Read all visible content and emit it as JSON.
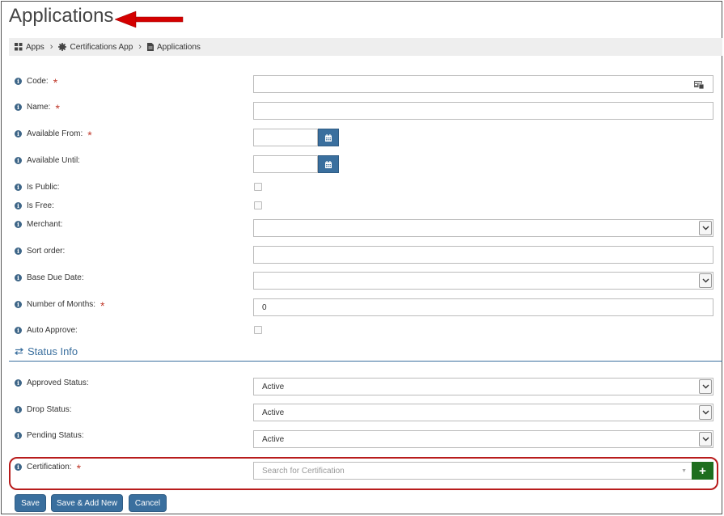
{
  "page": {
    "title": "Applications"
  },
  "breadcrumb": {
    "items": [
      {
        "label": "Apps",
        "icon": "grid-icon"
      },
      {
        "label": "Certifications App",
        "icon": "gear-icon"
      },
      {
        "label": "Applications",
        "icon": "document-icon"
      }
    ]
  },
  "form": {
    "code": {
      "label": "Code:",
      "value": ""
    },
    "name": {
      "label": "Name:",
      "value": ""
    },
    "available_from": {
      "label": "Available From:",
      "value": ""
    },
    "available_until": {
      "label": "Available Until:",
      "value": ""
    },
    "is_public": {
      "label": "Is Public:"
    },
    "is_free": {
      "label": "Is Free:"
    },
    "merchant": {
      "label": "Merchant:",
      "value": ""
    },
    "sort_order": {
      "label": "Sort order:",
      "value": ""
    },
    "base_due_date": {
      "label": "Base Due Date:",
      "value": ""
    },
    "number_of_months": {
      "label": "Number of Months:",
      "value": "0"
    },
    "auto_approve": {
      "label": "Auto Approve:"
    }
  },
  "status_section": {
    "title": "Status Info",
    "approved_status": {
      "label": "Approved Status:",
      "value": "Active"
    },
    "drop_status": {
      "label": "Drop Status:",
      "value": "Active"
    },
    "pending_status": {
      "label": "Pending Status:",
      "value": "Active"
    }
  },
  "certification": {
    "label": "Certification:",
    "placeholder": "Search for Certification",
    "add_label": "+"
  },
  "actions": {
    "save": "Save",
    "save_add_new": "Save & Add New",
    "cancel": "Cancel"
  },
  "colors": {
    "accent": "#3a6f9e",
    "required": "#c0392b",
    "add_button": "#1f6e1f",
    "highlight": "#b81c1c",
    "arrow": "#d40000"
  }
}
